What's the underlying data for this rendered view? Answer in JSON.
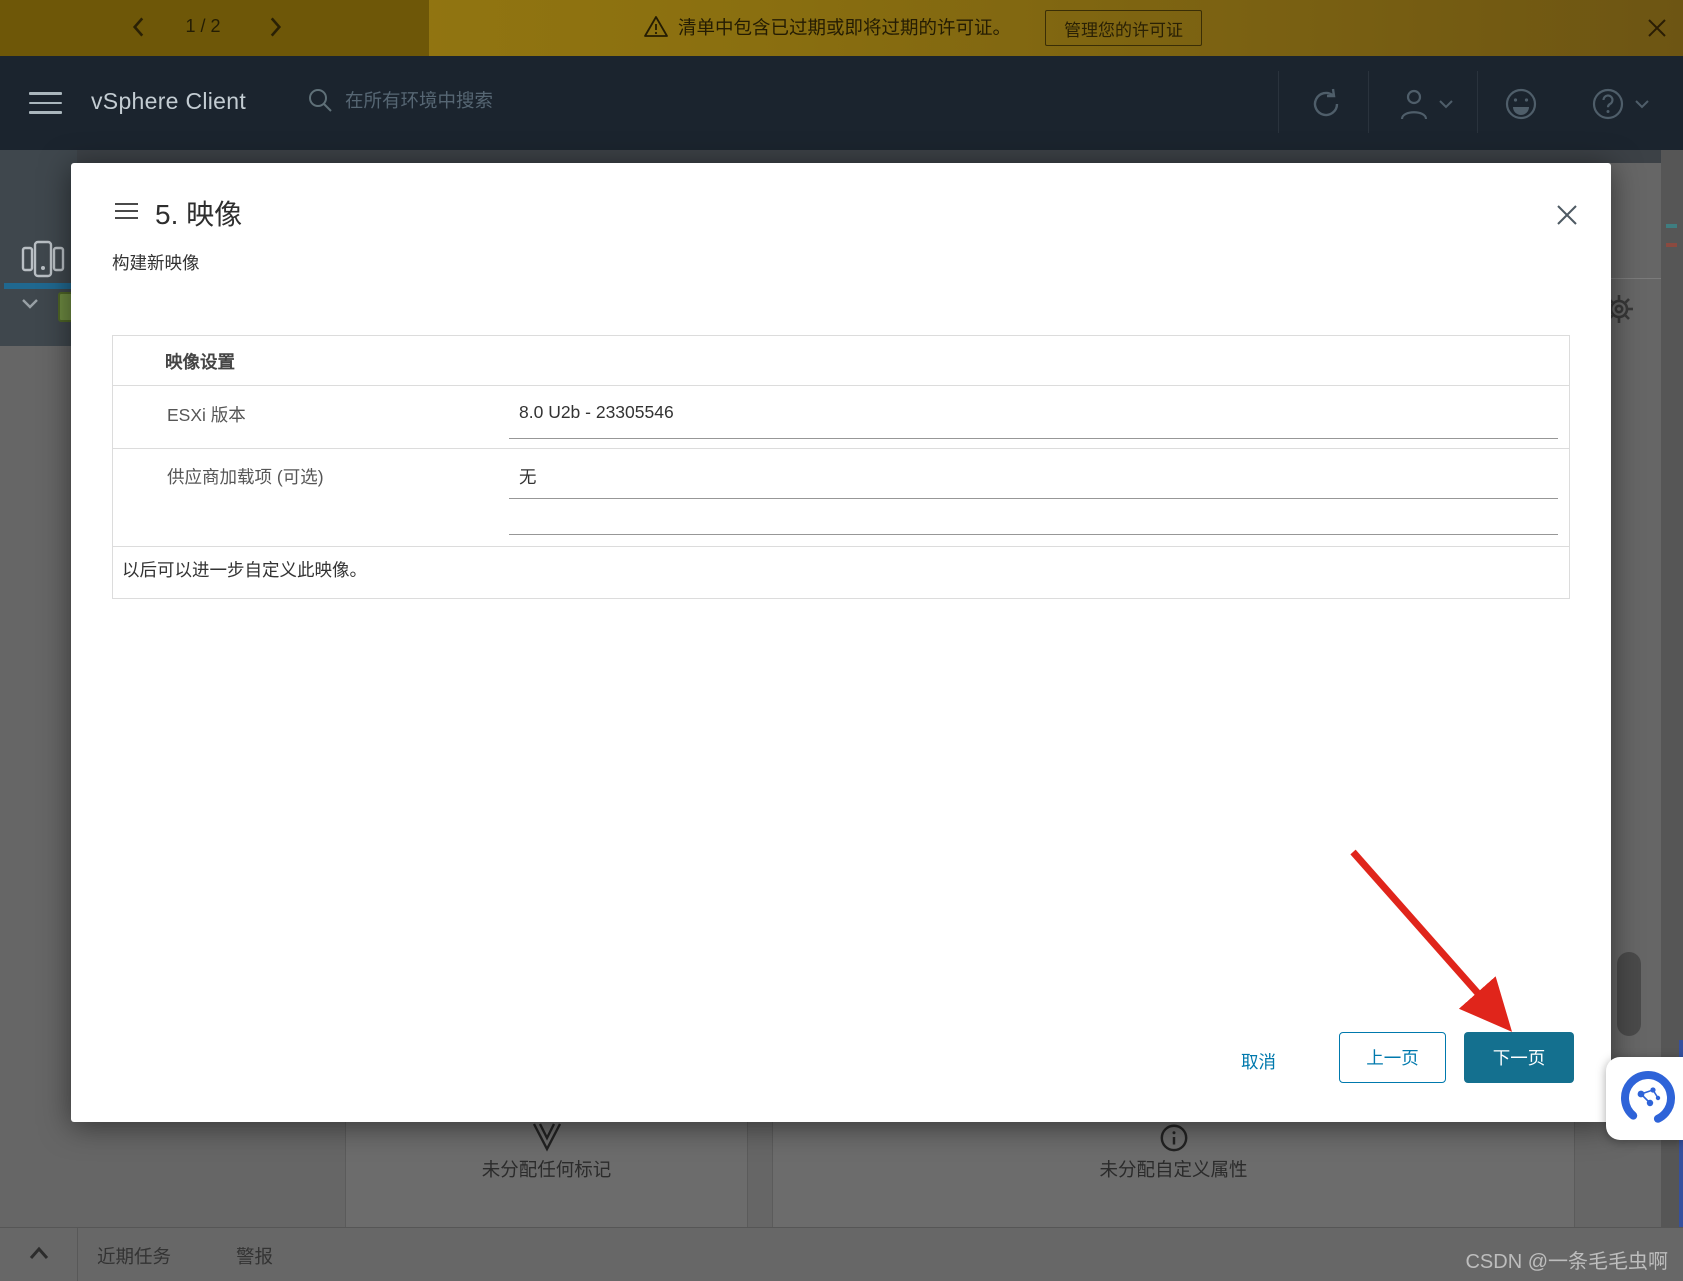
{
  "banner": {
    "pagination": "1 / 2",
    "warning_text": "清单中包含已过期或即将过期的许可证。",
    "manage_button": "管理您的许可证",
    "bg_color": "#8a6f10"
  },
  "header": {
    "app_title": "vSphere Client",
    "search_placeholder": "在所有环境中搜索"
  },
  "dialog": {
    "step_title": "5. 映像",
    "subtitle": "构建新映像",
    "table": {
      "header": "映像设置",
      "rows": [
        {
          "label": "ESXi 版本",
          "value": "8.0 U2b - 23305546"
        },
        {
          "label": "供应商加载项 (可选)",
          "value": "无"
        }
      ],
      "note": "以后可以进一步自定义此映像。"
    },
    "buttons": {
      "cancel": "取消",
      "previous": "上一页",
      "next": "下一页"
    },
    "accent_color": "#0079ad",
    "primary_color": "#14708f"
  },
  "background": {
    "tags_card_label": "未分配任何标记",
    "attributes_card_label": "未分配自定义属性",
    "footer_tabs": [
      "近期任务",
      "警报"
    ],
    "watermark": "CSDN @一条毛毛虫啊"
  }
}
